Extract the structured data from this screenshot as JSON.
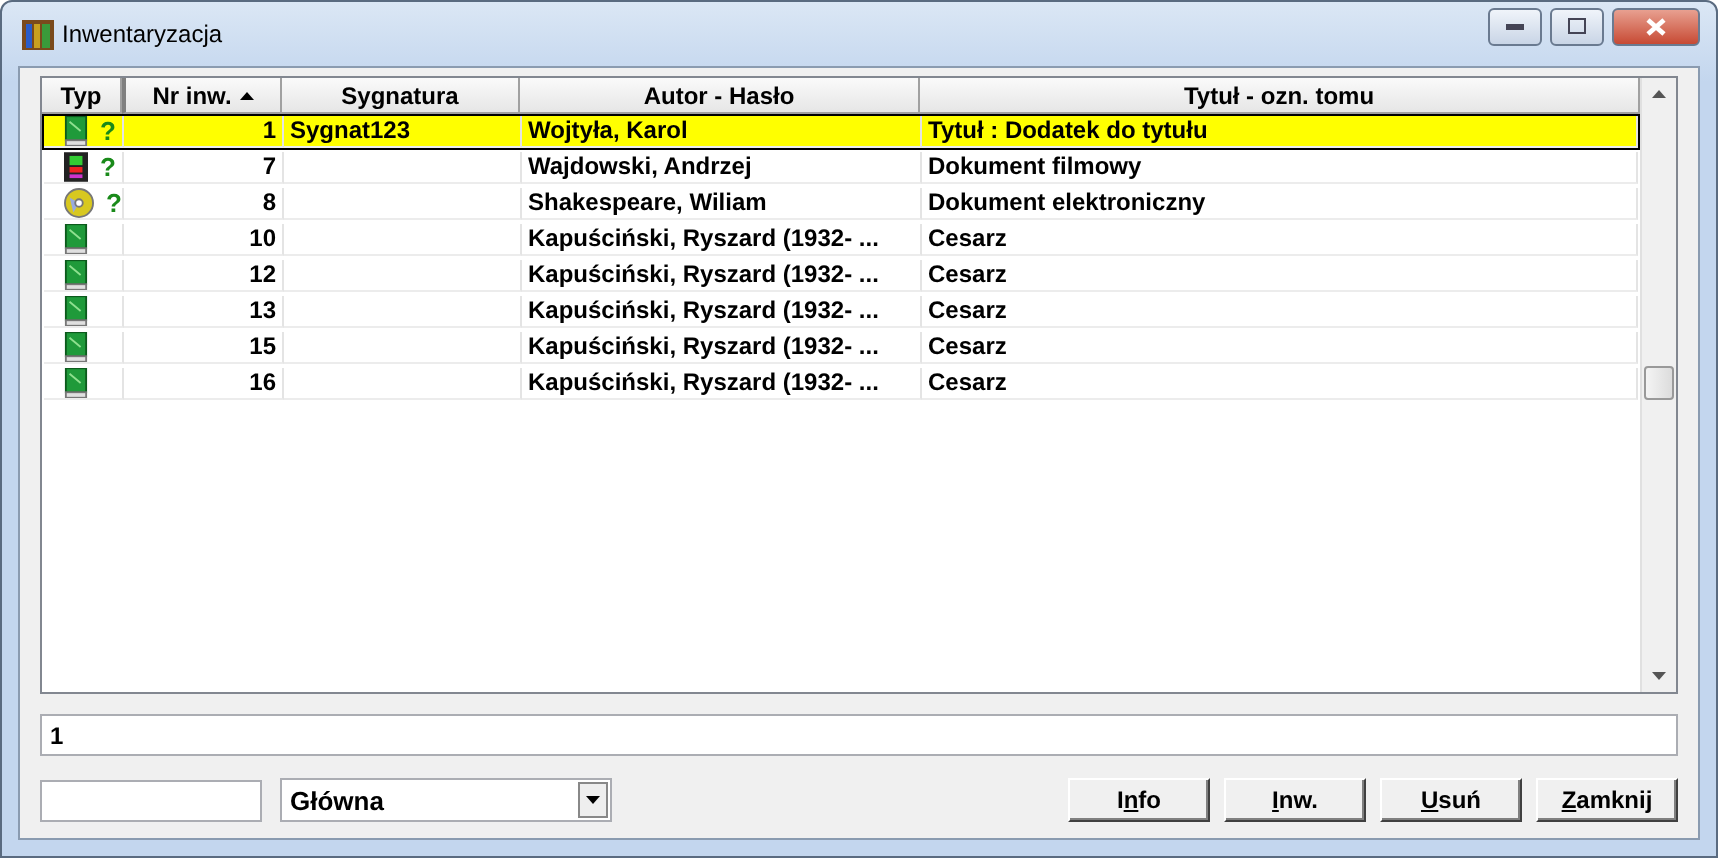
{
  "window": {
    "title": "Inwentaryzacja"
  },
  "table": {
    "columns": [
      {
        "label": "Typ",
        "sorted": false
      },
      {
        "label": "Nr inw.",
        "sorted": true
      },
      {
        "label": "Sygnatura",
        "sorted": false
      },
      {
        "label": "Autor - Hasło",
        "sorted": false
      },
      {
        "label": "Tytuł - ozn. tomu",
        "sorted": false
      }
    ],
    "rows": [
      {
        "kind": "book",
        "status": "?",
        "number": "1",
        "signature": "Sygnat123",
        "author": "Wojtyła, Karol",
        "title": "Tytuł : Dodatek do tytułu",
        "selected": true
      },
      {
        "kind": "film",
        "status": "?",
        "number": "7",
        "author": "Wajdowski, Andrzej",
        "title": "Dokument filmowy",
        "selected": false
      },
      {
        "kind": "disc",
        "status": "?",
        "number": "8",
        "author": "Shakespeare, Wiliam",
        "title": "Dokument elektroniczny",
        "selected": false
      },
      {
        "kind": "book",
        "number": "10",
        "author": "Kapuściński, Ryszard (1932- ...",
        "title": "Cesarz",
        "selected": false
      },
      {
        "kind": "book",
        "number": "12",
        "author": "Kapuściński, Ryszard (1932- ...",
        "title": "Cesarz",
        "selected": false
      },
      {
        "kind": "book",
        "number": "13",
        "author": "Kapuściński, Ryszard (1932- ...",
        "title": "Cesarz",
        "selected": false
      },
      {
        "kind": "book",
        "number": "15",
        "author": "Kapuściński, Ryszard (1932- ...",
        "title": "Cesarz",
        "selected": false
      },
      {
        "kind": "book",
        "number": "16",
        "author": "Kapuściński, Ryszard (1932- ...",
        "title": "Cesarz",
        "selected": false
      }
    ]
  },
  "detail_field": {
    "value": "1"
  },
  "bottom": {
    "dropdown": {
      "value": "Główna"
    },
    "buttons": [
      {
        "before": "I",
        "key": "n",
        "after": "fo"
      },
      {
        "key": "I",
        "after": "nw."
      },
      {
        "key": "U",
        "after": "suń"
      },
      {
        "key": "Z",
        "after": "amknij"
      }
    ]
  }
}
